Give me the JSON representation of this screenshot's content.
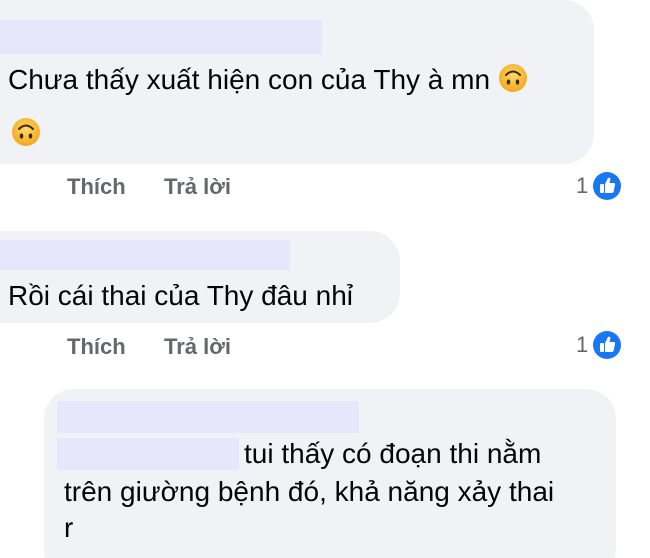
{
  "comments": [
    {
      "text_lines": [
        "Chưa thấy xuất hiện con của Thy à mn"
      ],
      "emoji": "upside-down-face",
      "actions": {
        "like": "Thích",
        "reply": "Trả lời"
      },
      "reaction_count": "1"
    },
    {
      "text_lines": [
        "Rồi cái thai của Thy đâu nhỉ"
      ],
      "actions": {
        "like": "Thích",
        "reply": "Trả lời"
      },
      "reaction_count": "1"
    },
    {
      "text_lines": [
        "tui thấy có đoạn thi nằm",
        "trên giường bệnh đó, khả năng xảy thai",
        "r"
      ]
    }
  ],
  "colors": {
    "bubble": "#f0f2f5",
    "redaction": "#e6e7fb",
    "action_text": "#65676b",
    "like_blue": "#1877f2"
  }
}
